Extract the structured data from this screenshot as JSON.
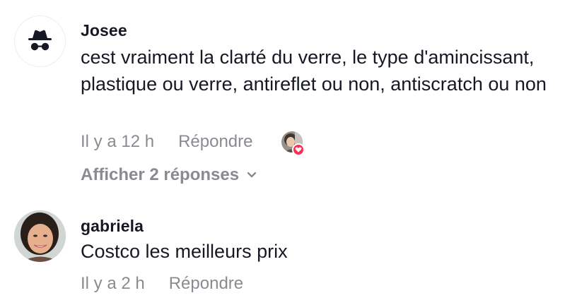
{
  "comments": [
    {
      "username": "Josee",
      "avatar_icon": "incognito-icon",
      "text": "cest vraiment la clarté du verre, le type d'amincissant, plastique ou verre, antireflet ou non, antiscratch ou non",
      "time": "Il y a 12 h",
      "reply_label": "Répondre",
      "liked_by_creator": true,
      "view_replies_label": "Afficher 2 réponses"
    },
    {
      "username": "gabriela",
      "avatar_icon": "user-photo",
      "text": "Costco les meilleurs prix",
      "time": "Il y a 2 h",
      "reply_label": "Répondre"
    }
  ],
  "colors": {
    "text": "#161823",
    "meta": "#8a8b91",
    "heart": "#fe2c55"
  }
}
